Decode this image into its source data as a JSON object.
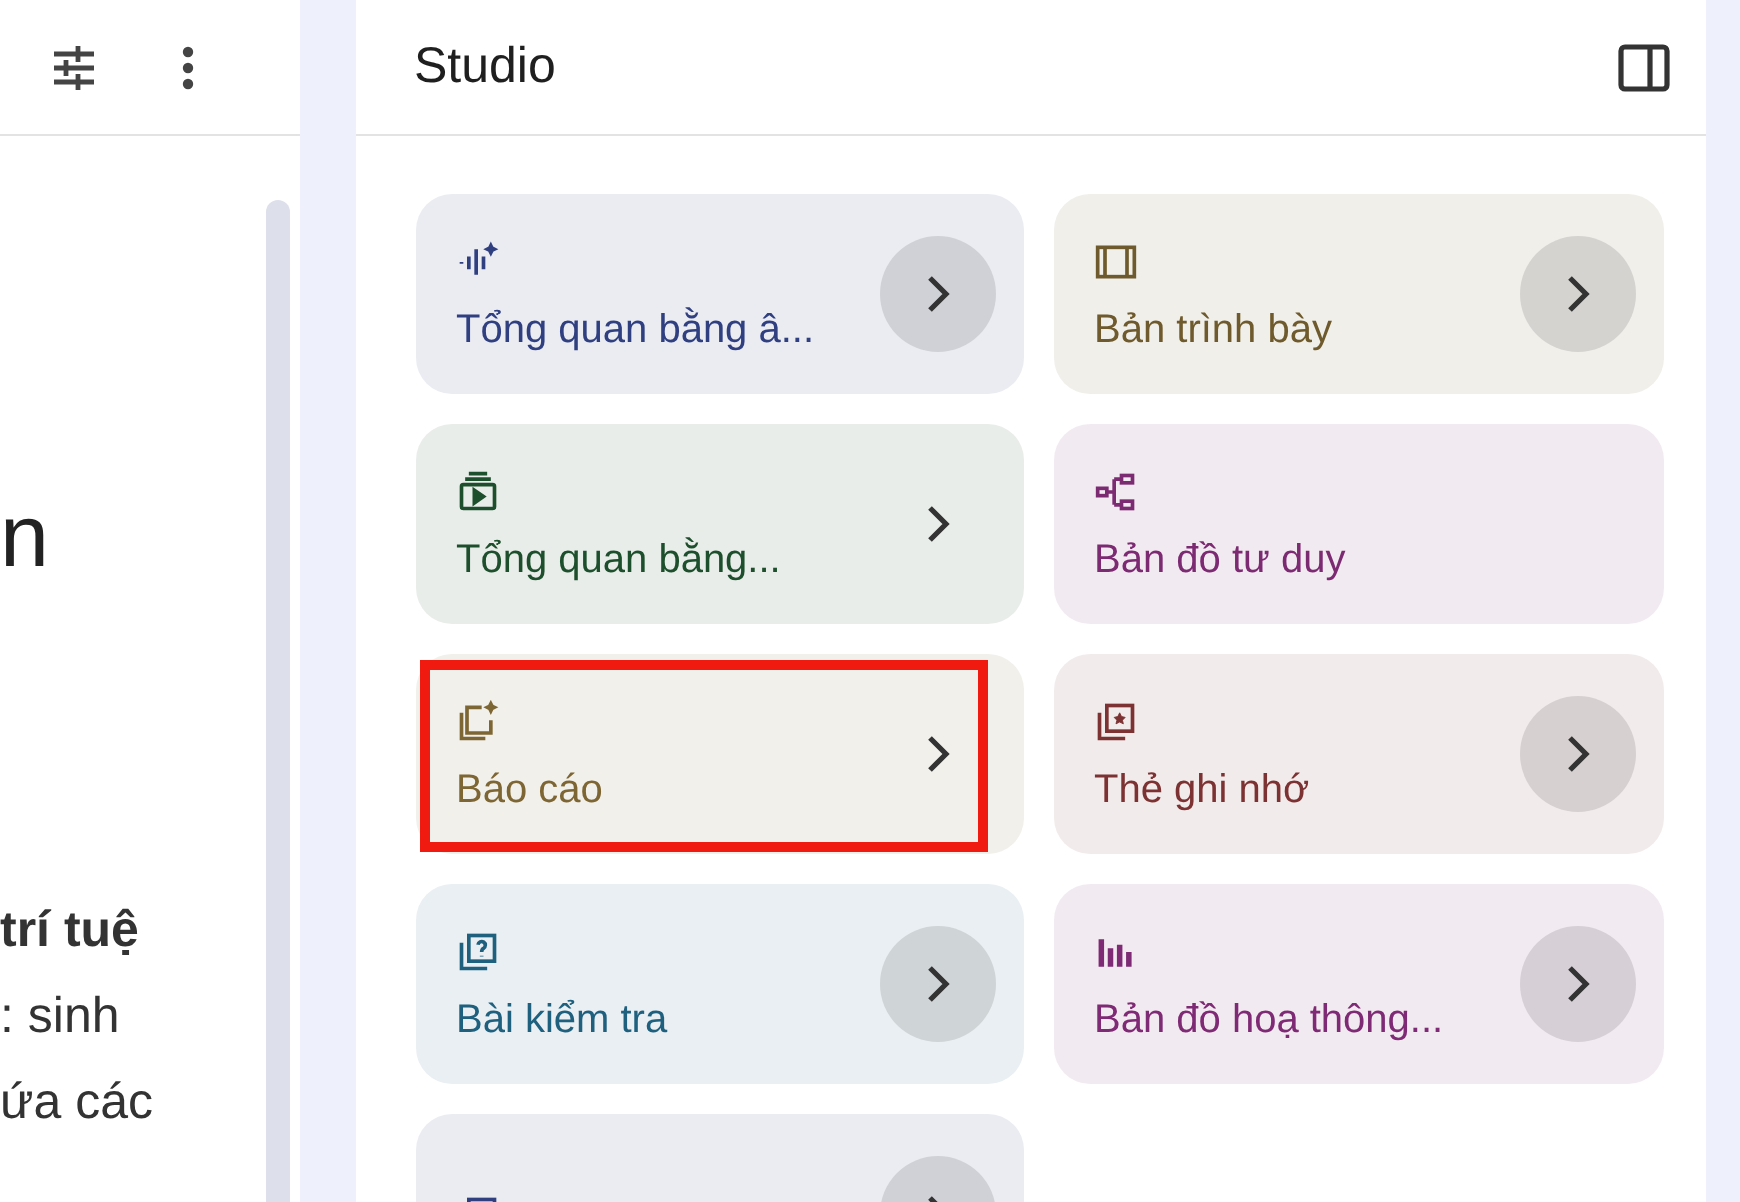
{
  "left_panel": {
    "heading_fragment": "n",
    "lines": [
      {
        "text": "trí tuệ",
        "bold": true
      },
      {
        "text": ": sinh",
        "bold": false
      },
      {
        "text": "ứa các",
        "bold": false
      }
    ]
  },
  "studio": {
    "title": "Studio"
  },
  "cards": [
    {
      "kind": "audio",
      "label": "Tổng quan bằng â...",
      "color": "#2f3f7f",
      "chevron": true,
      "chevron_shaded": true,
      "highlighted": false
    },
    {
      "kind": "slides",
      "label": "Bản trình bày",
      "color": "#6e5a2c",
      "chevron": true,
      "chevron_shaded": true,
      "highlighted": false
    },
    {
      "kind": "video",
      "label": "Tổng quan bằng...",
      "color": "#1e4f2c",
      "chevron": true,
      "chevron_shaded": false,
      "highlighted": false
    },
    {
      "kind": "mindmap",
      "label": "Bản đồ tư duy",
      "color": "#7c2a72",
      "chevron": false,
      "highlighted": false
    },
    {
      "kind": "report",
      "label": "Báo cáo",
      "color": "#7d6634",
      "chevron": true,
      "chevron_shaded": false,
      "highlighted": true
    },
    {
      "kind": "flashcards",
      "label": "Thẻ ghi nhớ",
      "color": "#7c3232",
      "chevron": true,
      "chevron_shaded": true,
      "highlighted": false
    },
    {
      "kind": "quiz",
      "label": "Bài kiểm tra",
      "color": "#1f607f",
      "chevron": true,
      "chevron_shaded": true,
      "highlighted": false
    },
    {
      "kind": "infographic",
      "label": "Bản đồ hoạ thông...",
      "color": "#7e2a74",
      "chevron": true,
      "chevron_shaded": true,
      "highlighted": false
    },
    {
      "kind": "table",
      "color": "#2f3f7f",
      "chevron": true,
      "chevron_shaded": true,
      "highlighted": false
    }
  ]
}
